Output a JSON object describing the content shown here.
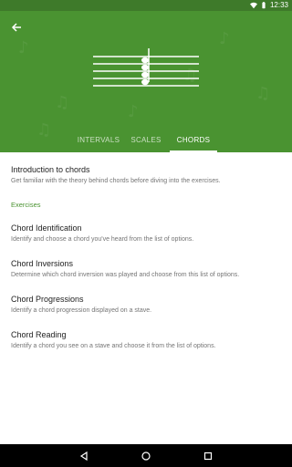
{
  "status_bar": {
    "time": "12:33"
  },
  "tabs": [
    {
      "label": "INTERVALS",
      "active": false
    },
    {
      "label": "SCALES",
      "active": false
    },
    {
      "label": "CHORDS",
      "active": true
    }
  ],
  "intro": {
    "title": "Introduction to chords",
    "subtitle": "Get familiar with the theory behind chords before diving into the exercises."
  },
  "exercises_label": "Exercises",
  "exercises": [
    {
      "title": "Chord Identification",
      "subtitle": "Identify and choose a chord you've heard from the list of options."
    },
    {
      "title": "Chord Inversions",
      "subtitle": "Determine which chord inversion was played and choose from this list of options."
    },
    {
      "title": "Chord Progressions",
      "subtitle": "Identify a chord progression displayed on a stave."
    },
    {
      "title": "Chord Reading",
      "subtitle": "Identify a chord you see on a stave and choose it from the list of options."
    }
  ],
  "icons": {
    "back": "arrow-back-icon",
    "wifi": "wifi-icon",
    "battery": "battery-icon",
    "nav_back": "nav-back-icon",
    "nav_home": "nav-home-icon",
    "nav_recents": "nav-recents-icon"
  },
  "colors": {
    "primary": "#4a9331",
    "status_bar": "#3e7a2a",
    "accent_text": "#4a9331"
  }
}
